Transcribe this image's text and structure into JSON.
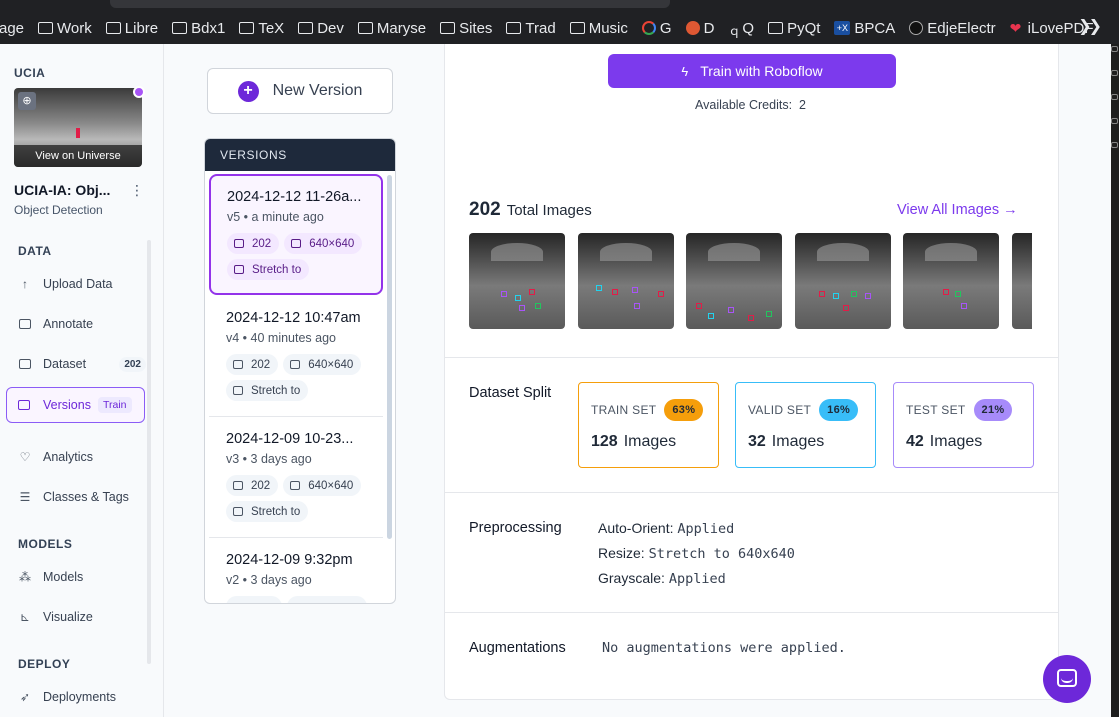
{
  "bookmarks": [
    {
      "label": "age",
      "icon": "folder-icon"
    },
    {
      "label": "Work",
      "icon": "folder-icon"
    },
    {
      "label": "Libre",
      "icon": "folder-icon"
    },
    {
      "label": "Bdx1",
      "icon": "folder-icon"
    },
    {
      "label": "TeX",
      "icon": "folder-icon"
    },
    {
      "label": "Dev",
      "icon": "folder-icon"
    },
    {
      "label": "Maryse",
      "icon": "folder-icon"
    },
    {
      "label": "Sites",
      "icon": "folder-icon"
    },
    {
      "label": "Trad",
      "icon": "folder-icon"
    },
    {
      "label": "Music",
      "icon": "folder-icon"
    },
    {
      "label": "G",
      "icon": "google-icon"
    },
    {
      "label": "D",
      "icon": "duckduckgo-icon"
    },
    {
      "label": "Q",
      "icon": "qwant-icon"
    },
    {
      "label": "PyQt",
      "icon": "folder-icon"
    },
    {
      "label": "BPCA",
      "icon": "bpca-icon"
    },
    {
      "label": "EdjeElectr",
      "icon": "github-icon"
    },
    {
      "label": "iLovePDF",
      "icon": "heart-icon"
    }
  ],
  "sidebar": {
    "workspace": "UCIA",
    "view_universe": "View on Universe",
    "project_name": "UCIA-IA: Obj...",
    "project_type": "Object Detection",
    "sections": {
      "data": "DATA",
      "models": "MODELS",
      "deploy": "DEPLOY"
    },
    "items": {
      "upload": "Upload Data",
      "annotate": "Annotate",
      "dataset": "Dataset",
      "dataset_count": "202",
      "versions": "Versions",
      "versions_badge": "Train",
      "analytics": "Analytics",
      "classes": "Classes & Tags",
      "models": "Models",
      "visualize": "Visualize",
      "deployments": "Deployments"
    }
  },
  "versions": {
    "new_button": "New Version",
    "header": "VERSIONS",
    "list": [
      {
        "date": "2024-12-12 11-26a...",
        "sub": "v5 • a minute ago",
        "images": "202",
        "size": "640×640",
        "resize": "Stretch to"
      },
      {
        "date": "2024-12-12 10:47am",
        "sub": "v4 • 40 minutes ago",
        "images": "202",
        "size": "640×640",
        "resize": "Stretch to"
      },
      {
        "date": "2024-12-09 10-23...",
        "sub": "v3 • 3 days ago",
        "images": "202",
        "size": "640×640",
        "resize": "Stretch to"
      },
      {
        "date": "2024-12-09 9:32pm",
        "sub": "v2 • 3 days ago",
        "images": "",
        "size": "",
        "resize": ""
      }
    ]
  },
  "main": {
    "train_button": "Train with Roboflow",
    "credits_label": "Available Credits:",
    "credits_value": "2",
    "total_count": "202",
    "total_label": "Total Images",
    "view_all": "View All Images →",
    "split_label": "Dataset Split",
    "splits": [
      {
        "name": "TRAIN SET",
        "pct": "63%",
        "count": "128",
        "unit": "Images",
        "border": "#f59e0b",
        "badge": "#f59e0b"
      },
      {
        "name": "VALID SET",
        "pct": "16%",
        "count": "32",
        "unit": "Images",
        "border": "#38bdf8",
        "badge": "#38bdf8"
      },
      {
        "name": "TEST SET",
        "pct": "21%",
        "count": "42",
        "unit": "Images",
        "border": "#a78bfa",
        "badge": "#a78bfa"
      }
    ],
    "preprocessing_label": "Preprocessing",
    "preprocessing": [
      {
        "key": "Auto-Orient:",
        "value": "Applied"
      },
      {
        "key": "Resize:",
        "value": "Stretch to 640x640"
      },
      {
        "key": "Grayscale:",
        "value": "Applied"
      }
    ],
    "augmentations_label": "Augmentations",
    "augmentations_value": "No augmentations were applied."
  },
  "colors": {
    "accent": "#7c3aed",
    "dark_header": "#1e293b"
  }
}
